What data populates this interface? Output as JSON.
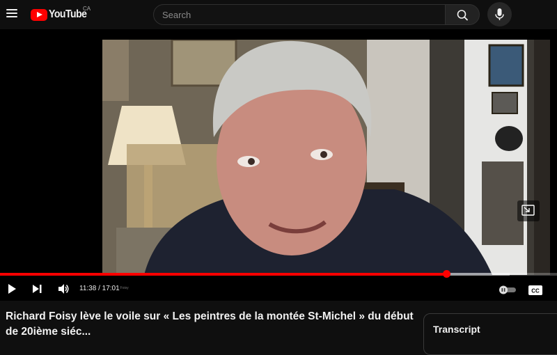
{
  "header": {
    "logo_text": "YouTube",
    "country_code": "CA",
    "search_placeholder": "Search"
  },
  "player": {
    "current_time": "11:38",
    "separator": " / ",
    "duration": "17:01",
    "chapter_text": "Foisy",
    "progress_fraction": 0.801,
    "buffered_fraction": 0.915
  },
  "video": {
    "title": "Richard Foisy lève le voile sur « Les peintres de la montée St-Michel » du début de 20ième siéc..."
  },
  "sidebar": {
    "transcript_label": "Transcript"
  },
  "colors": {
    "brand_red": "#ff0000",
    "background": "#0f0f0f"
  },
  "icons": [
    "menu-icon",
    "youtube-logo-icon",
    "search-icon",
    "microphone-icon",
    "play-icon",
    "next-icon",
    "volume-icon",
    "autoplay-toggle-icon",
    "captions-icon",
    "miniplayer-icon"
  ]
}
